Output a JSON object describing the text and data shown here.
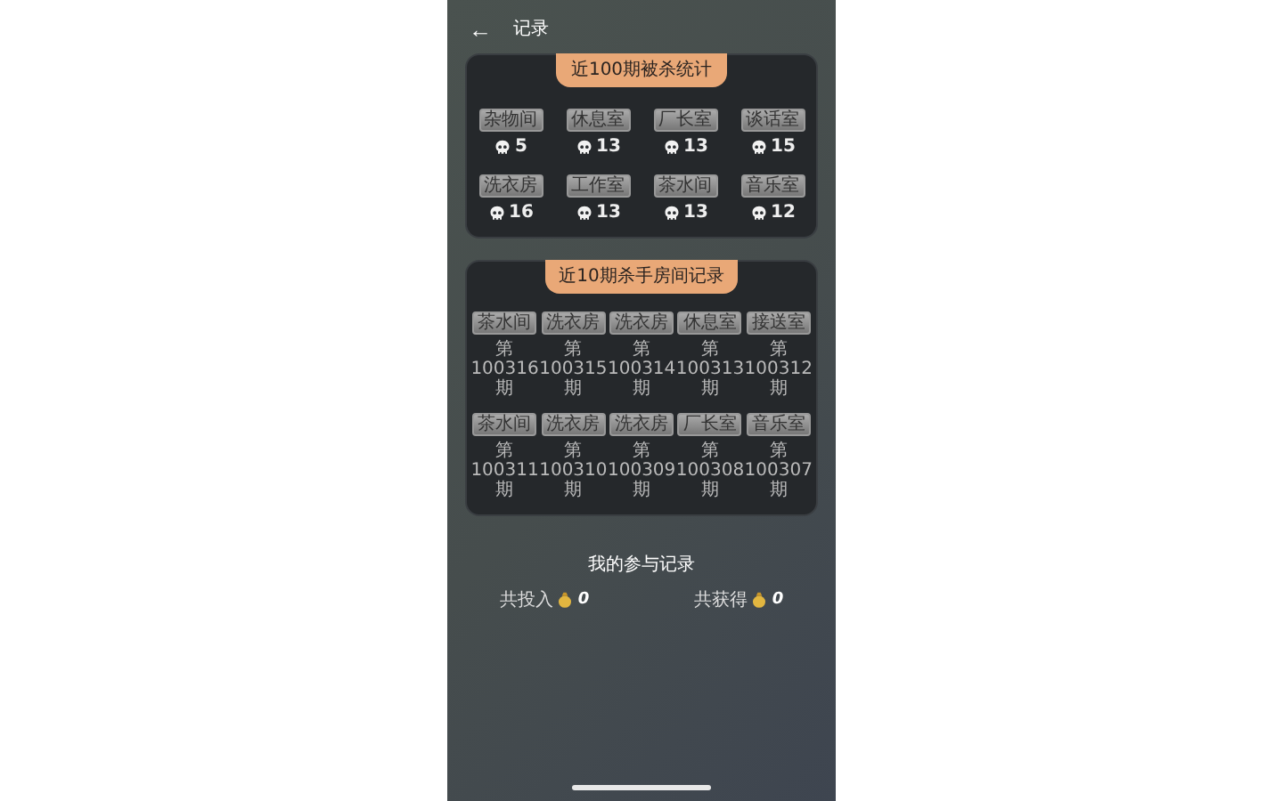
{
  "header": {
    "back": "←",
    "title": "记录"
  },
  "kill_stats": {
    "title": "近100期被杀统计",
    "rooms": [
      {
        "name": "杂物间",
        "count": "5"
      },
      {
        "name": "休息室",
        "count": "13"
      },
      {
        "name": "厂长室",
        "count": "13"
      },
      {
        "name": "谈话室",
        "count": "15"
      },
      {
        "name": "洗衣房",
        "count": "16"
      },
      {
        "name": "工作室",
        "count": "13"
      },
      {
        "name": "茶水间",
        "count": "13"
      },
      {
        "name": "音乐室",
        "count": "12"
      }
    ]
  },
  "killer_rooms": {
    "title": "近10期杀手房间记录",
    "records": [
      {
        "room": "茶水间",
        "period": "第100316期"
      },
      {
        "room": "洗衣房",
        "period": "第100315期"
      },
      {
        "room": "洗衣房",
        "period": "第100314期"
      },
      {
        "room": "休息室",
        "period": "第100313期"
      },
      {
        "room": "接送室",
        "period": "第100312期"
      },
      {
        "room": "茶水间",
        "period": "第100311期"
      },
      {
        "room": "洗衣房",
        "period": "第100310期"
      },
      {
        "room": "洗衣房",
        "period": "第100309期"
      },
      {
        "room": "厂长室",
        "period": "第100308期"
      },
      {
        "room": "音乐室",
        "period": "第100307期"
      }
    ]
  },
  "my_record": {
    "title": "我的参与记录",
    "invested_label": "共投入",
    "invested": "0",
    "won_label": "共获得",
    "won": "0"
  }
}
